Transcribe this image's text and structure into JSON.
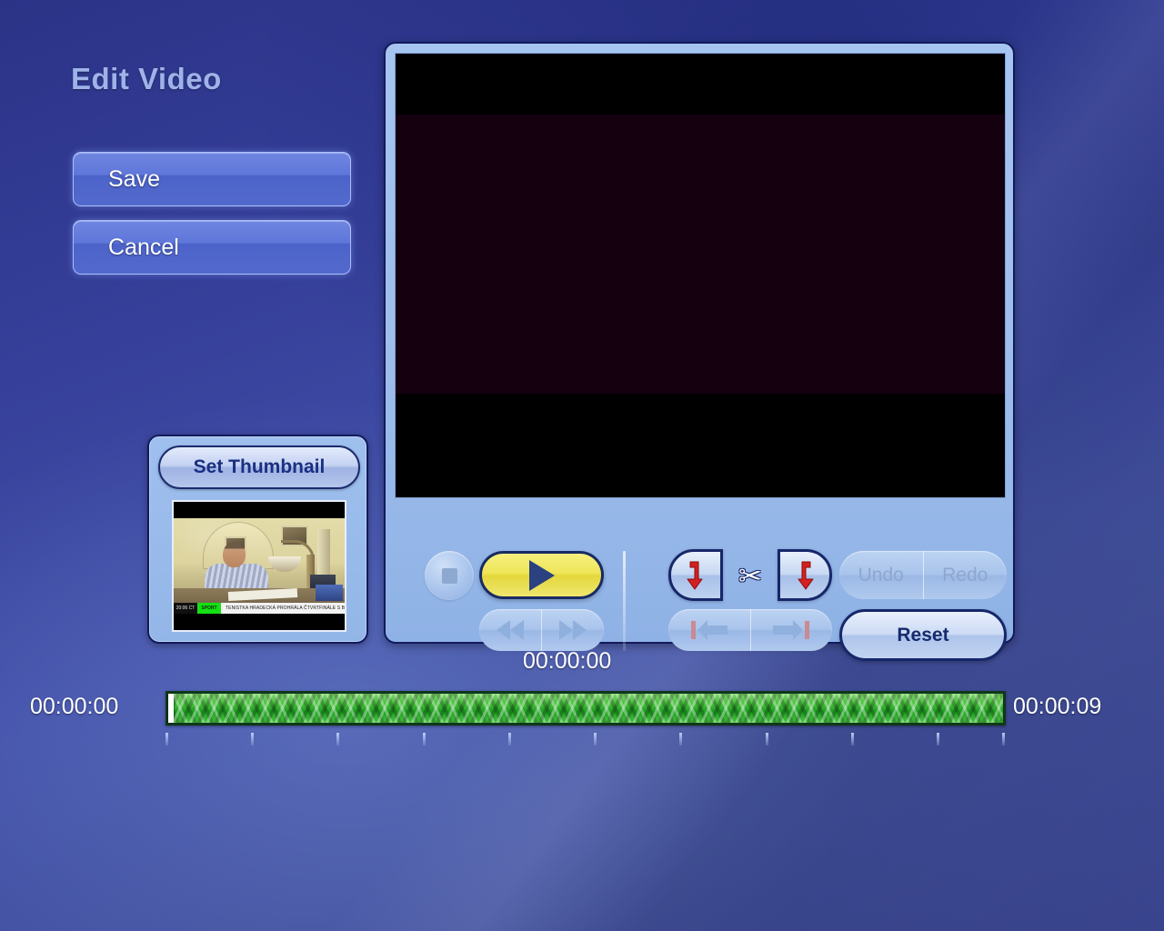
{
  "page": {
    "title": "Edit Video",
    "accent_blue": "#4250a8",
    "panel_blue": "#9cbcea",
    "panel_border": "#121a5e",
    "play_yellow": "#eee558",
    "timeline_green": "#49bf3f",
    "trim_red": "#d42020"
  },
  "actions": {
    "save_label": "Save",
    "cancel_label": "Cancel"
  },
  "thumbnail": {
    "set_thumbnail_label": "Set Thumbnail",
    "ticker": {
      "time": "20:06 CT",
      "tag": "SPORT",
      "headline": "TENISTKA HRADECKÁ PROHRÁLA ČTVRTFINÁLE S BAMMEROVOU."
    }
  },
  "controls": {
    "stop_label": "Stop",
    "play_label": "Play",
    "rewind_label": "Rewind",
    "fast_forward_label": "Fast Forward",
    "trim_start_label": "Set Trim Start",
    "trim_end_label": "Set Trim End",
    "cut_label": "Cut",
    "jump_start_label": "Jump To Start",
    "jump_end_label": "Jump To End",
    "undo_label": "Undo",
    "redo_label": "Redo",
    "reset_label": "Reset"
  },
  "timeline": {
    "playhead_time": "00:00:00",
    "start_time": "00:00:00",
    "end_time": "00:00:09",
    "playhead_percent": 0,
    "tick_count": 10,
    "tick_percents": [
      0,
      10.2,
      20.4,
      30.6,
      40.8,
      51,
      61.2,
      71.4,
      81.6,
      91.8,
      99.6
    ]
  }
}
